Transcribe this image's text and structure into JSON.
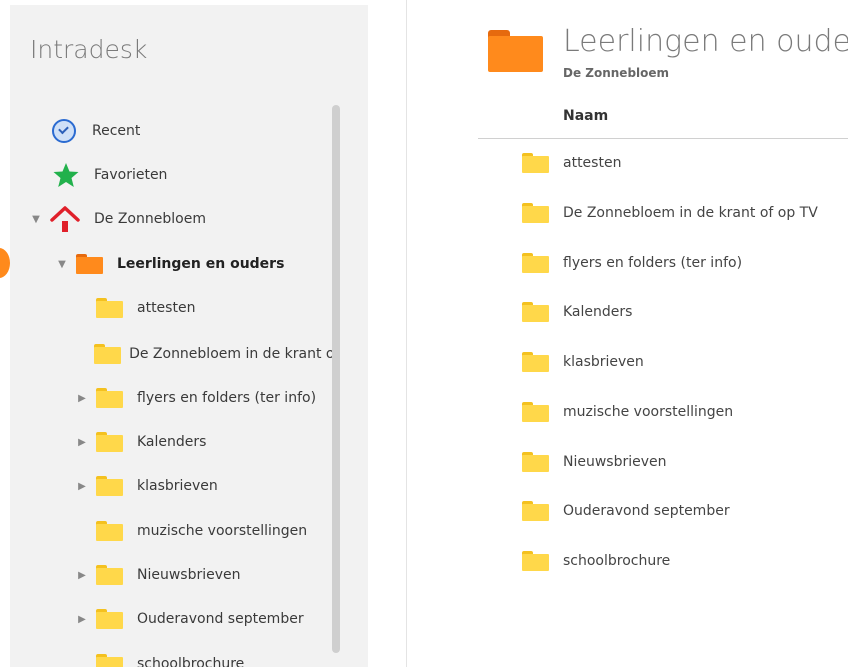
{
  "sidebar": {
    "title": "Intradesk",
    "items": [
      {
        "label": "Recent",
        "icon": "clock-icon"
      },
      {
        "label": "Favorieten",
        "icon": "star-icon"
      },
      {
        "label": "De Zonnebloem",
        "icon": "home-icon",
        "expanded": true
      },
      {
        "label": "Leerlingen en ouders",
        "icon": "folder-icon",
        "expanded": true,
        "selected": true
      },
      {
        "label": "attesten",
        "icon": "folder-icon"
      },
      {
        "label": "De Zonnebloem in de krant of op TV",
        "icon": "folder-icon"
      },
      {
        "label": "flyers en folders (ter info)",
        "icon": "folder-icon",
        "has_children": true
      },
      {
        "label": "Kalenders",
        "icon": "folder-icon",
        "has_children": true
      },
      {
        "label": "klasbrieven",
        "icon": "folder-icon",
        "has_children": true
      },
      {
        "label": "muzische voorstellingen",
        "icon": "folder-icon"
      },
      {
        "label": "Nieuwsbrieven",
        "icon": "folder-icon",
        "has_children": true
      },
      {
        "label": "Ouderavond september",
        "icon": "folder-icon",
        "has_children": true
      },
      {
        "label": "schoolbrochure",
        "icon": "folder-icon"
      }
    ]
  },
  "main": {
    "title": "Leerlingen en ouders",
    "subtitle": "De Zonnebloem",
    "column_header": "Naam",
    "rows": [
      "attesten",
      "De Zonnebloem in de krant of op TV",
      "flyers en folders (ter info)",
      "Kalenders",
      "klasbrieven",
      "muzische voorstellingen",
      "Nieuwsbrieven",
      "Ouderavond september",
      "schoolbrochure"
    ]
  },
  "colors": {
    "accent_orange": "#ff8a1c",
    "folder_yellow": "#ffd84a",
    "home_red": "#e0202a",
    "star_green": "#22b14c",
    "clock_blue": "#2b6bd1"
  }
}
